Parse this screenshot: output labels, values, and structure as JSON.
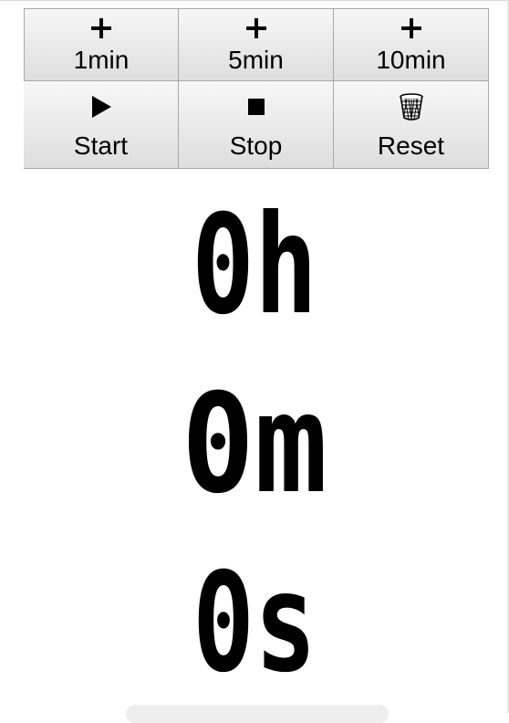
{
  "controls": {
    "add_buttons": [
      {
        "icon": "plus-icon",
        "symbol": "+",
        "label": "1min"
      },
      {
        "icon": "plus-icon",
        "symbol": "+",
        "label": "5min"
      },
      {
        "icon": "plus-icon",
        "symbol": "+",
        "label": "10min"
      }
    ],
    "start": {
      "icon": "play-icon",
      "label": "Start"
    },
    "stop": {
      "icon": "stop-icon",
      "label": "Stop"
    },
    "reset": {
      "icon": "trash-icon",
      "label": "Reset"
    }
  },
  "timer": {
    "hours": "0h",
    "minutes": "0m",
    "seconds": "0s"
  }
}
